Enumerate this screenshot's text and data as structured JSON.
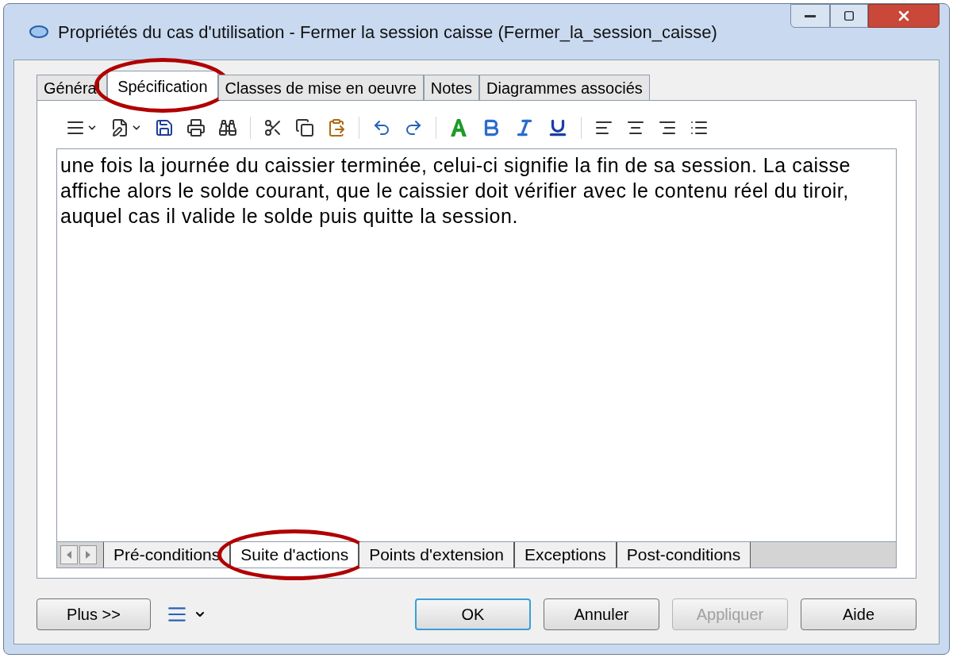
{
  "window": {
    "title": "Propriétés du cas d'utilisation - Fermer la session caisse (Fermer_la_session_caisse)"
  },
  "tabs": [
    {
      "label": "Général",
      "selected": false,
      "circled": false
    },
    {
      "label": "Spécification",
      "selected": true,
      "circled": true
    },
    {
      "label": "Classes de mise en oeuvre",
      "selected": false,
      "circled": false
    },
    {
      "label": "Notes",
      "selected": false,
      "circled": false
    },
    {
      "label": "Diagrammes associés",
      "selected": false,
      "circled": false
    }
  ],
  "editor": {
    "value": "une fois la journée du caissier terminée, celui-ci signifie la fin de sa session. La caisse affiche alors le solde courant, que le caissier doit vérifier avec le contenu réel du tiroir, auquel cas il valide le solde puis quitte la session."
  },
  "sub_tabs": [
    {
      "label": "Pré-conditions",
      "selected": false,
      "circled": false
    },
    {
      "label": "Suite d'actions",
      "selected": true,
      "circled": true
    },
    {
      "label": "Points d'extension",
      "selected": false,
      "circled": false
    },
    {
      "label": "Exceptions",
      "selected": false,
      "circled": false
    },
    {
      "label": "Post-conditions",
      "selected": false,
      "circled": false
    }
  ],
  "more_button": {
    "label": "Plus >>"
  },
  "buttons": [
    {
      "label": "OK",
      "default": true,
      "disabled": false
    },
    {
      "label": "Annuler",
      "default": false,
      "disabled": false
    },
    {
      "label": "Appliquer",
      "default": false,
      "disabled": true
    },
    {
      "label": "Aide",
      "default": false,
      "disabled": false
    }
  ]
}
